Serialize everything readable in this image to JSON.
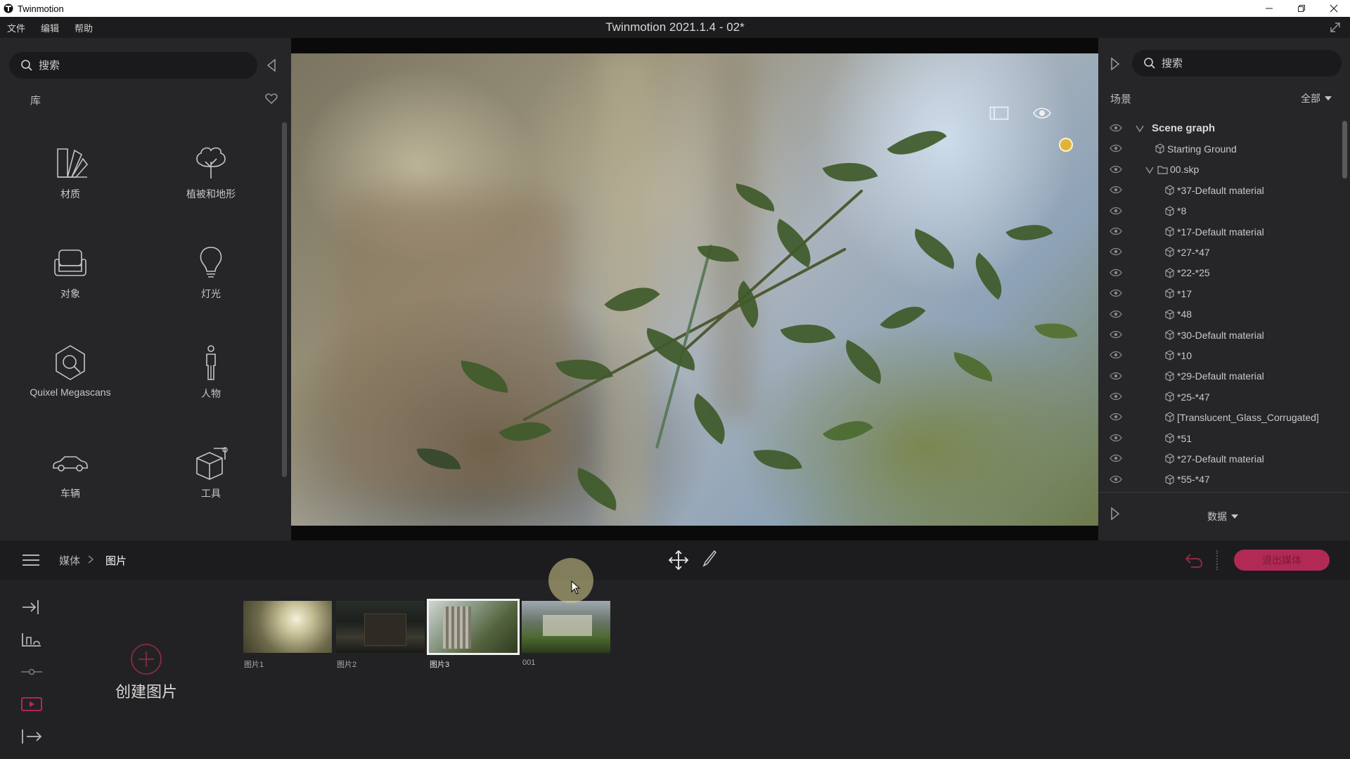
{
  "titlebar": {
    "app_name": "Twinmotion"
  },
  "menubar": {
    "items": [
      "文件",
      "编辑",
      "帮助"
    ],
    "doc_title": "Twinmotion 2021.1.4 - 02*"
  },
  "library": {
    "search_placeholder": "搜索",
    "section_label": "库",
    "items": [
      {
        "label": "材质",
        "icon": "material-icon"
      },
      {
        "label": "植被和地形",
        "icon": "tree-icon"
      },
      {
        "label": "对象",
        "icon": "sofa-icon"
      },
      {
        "label": "灯光",
        "icon": "bulb-icon"
      },
      {
        "label": "Quixel Megascans",
        "icon": "megascans-icon"
      },
      {
        "label": "人物",
        "icon": "person-icon"
      },
      {
        "label": "车辆",
        "icon": "car-icon"
      },
      {
        "label": "工具",
        "icon": "tools-box-icon"
      }
    ]
  },
  "scene_panel": {
    "search_placeholder": "搜索",
    "section_label": "场景",
    "filter": "全部",
    "tree": [
      {
        "label": "Scene graph",
        "level": 0,
        "caret": true,
        "type": "root"
      },
      {
        "label": "Starting Ground",
        "level": 1,
        "caret": false,
        "type": "mesh"
      },
      {
        "label": "00.skp",
        "level": 1,
        "caret": true,
        "type": "folder"
      },
      {
        "label": "*37-Default material",
        "level": 2,
        "caret": false,
        "type": "mesh"
      },
      {
        "label": "*8",
        "level": 2,
        "caret": false,
        "type": "mesh"
      },
      {
        "label": "*17-Default material",
        "level": 2,
        "caret": false,
        "type": "mesh"
      },
      {
        "label": "*27-*47",
        "level": 2,
        "caret": false,
        "type": "mesh"
      },
      {
        "label": "*22-*25",
        "level": 2,
        "caret": false,
        "type": "mesh"
      },
      {
        "label": "*17",
        "level": 2,
        "caret": false,
        "type": "mesh"
      },
      {
        "label": "*48",
        "level": 2,
        "caret": false,
        "type": "mesh"
      },
      {
        "label": "*30-Default material",
        "level": 2,
        "caret": false,
        "type": "mesh"
      },
      {
        "label": "*10",
        "level": 2,
        "caret": false,
        "type": "mesh"
      },
      {
        "label": "*29-Default material",
        "level": 2,
        "caret": false,
        "type": "mesh"
      },
      {
        "label": "*25-*47",
        "level": 2,
        "caret": false,
        "type": "mesh"
      },
      {
        "label": "[Translucent_Glass_Corrugated]",
        "level": 2,
        "caret": false,
        "type": "mesh"
      },
      {
        "label": "*51",
        "level": 2,
        "caret": false,
        "type": "mesh"
      },
      {
        "label": "*27-Default material",
        "level": 2,
        "caret": false,
        "type": "mesh"
      },
      {
        "label": "*55-*47",
        "level": 2,
        "caret": false,
        "type": "mesh"
      }
    ],
    "data_dropdown": "数据"
  },
  "toolbar": {
    "breadcrumb": [
      "媒体",
      "图片"
    ],
    "exit_label": "退出媒体"
  },
  "media": {
    "create_label": "创建图片",
    "thumbnails": [
      {
        "label": "图片1",
        "selected": false
      },
      {
        "label": "图片2",
        "selected": false
      },
      {
        "label": "图片3",
        "selected": true
      },
      {
        "label": "001",
        "selected": false
      }
    ]
  },
  "colors": {
    "accent": "#b02a55",
    "panel": "#262628",
    "background": "#1f1f21"
  }
}
